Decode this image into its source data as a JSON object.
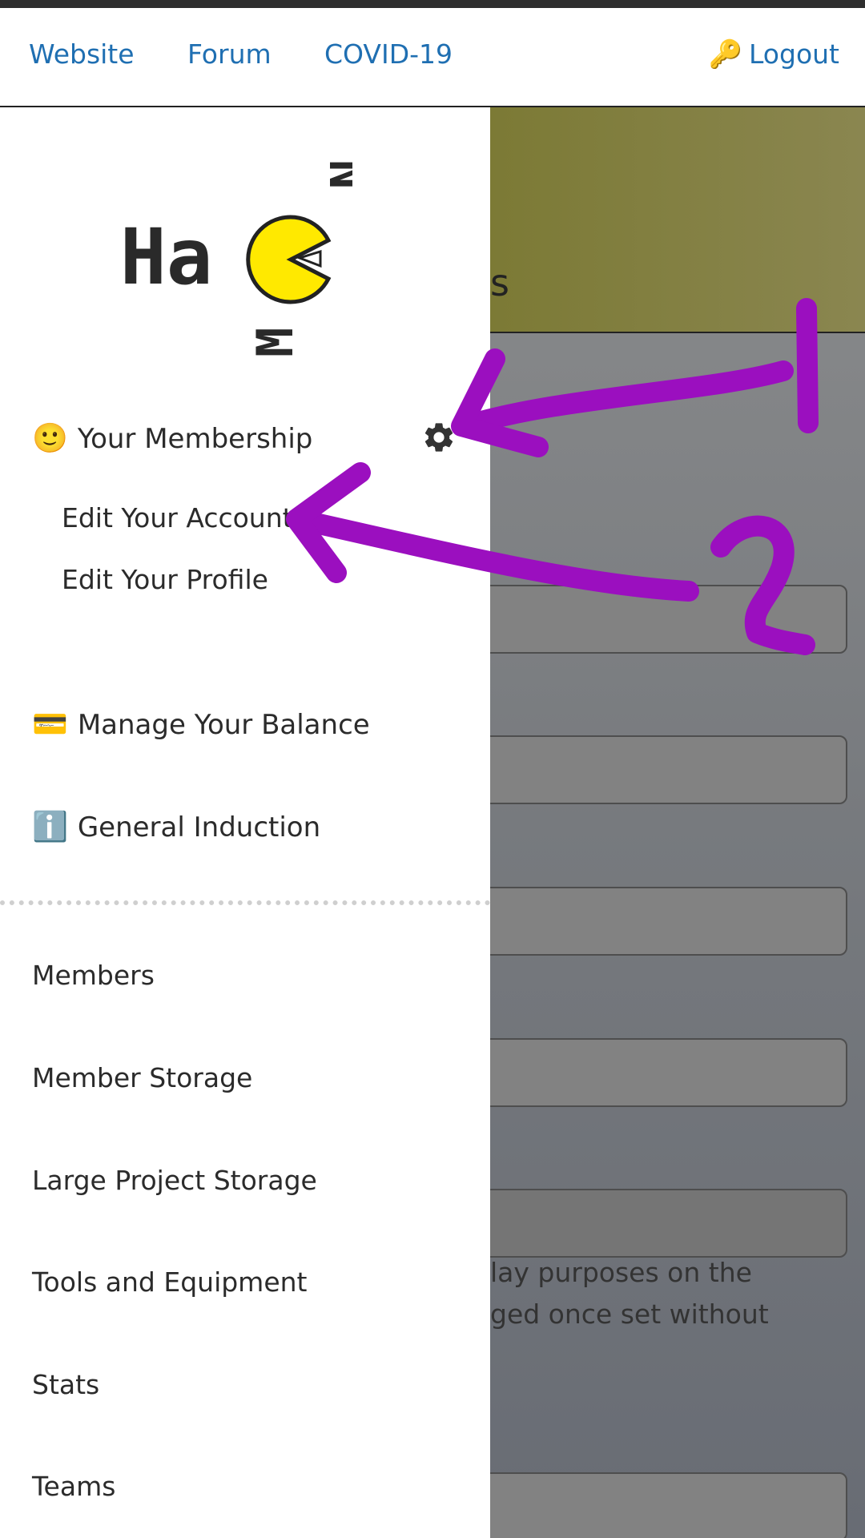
{
  "topnav": {
    "links": [
      "Website",
      "Forum",
      "COVID-19"
    ],
    "logout_icon": "🔑",
    "logout_label": "Logout"
  },
  "logo": {
    "text": "Ha",
    "letters": "MN",
    "pacman_color": "#ffe900"
  },
  "sidebar": {
    "membership": {
      "emoji": "🙂",
      "label": "Your Membership",
      "settings_icon": "gear-icon"
    },
    "sub_items": [
      "Edit Your Account",
      "Edit Your Profile"
    ],
    "balance": {
      "emoji": "💳",
      "label": "Manage Your Balance"
    },
    "induction": {
      "emoji": "ℹ️",
      "label": "General Induction"
    },
    "nav": [
      "Members",
      "Member Storage",
      "Large Project Storage",
      "Tools and Equipment",
      "Stats",
      "Teams"
    ]
  },
  "background_page": {
    "banner_fragment": "s",
    "help_lines": [
      "lay purposes on the",
      "ged once set without"
    ]
  },
  "annotations": {
    "color": "#9b0fbf",
    "labels": [
      "1",
      "2"
    ]
  }
}
